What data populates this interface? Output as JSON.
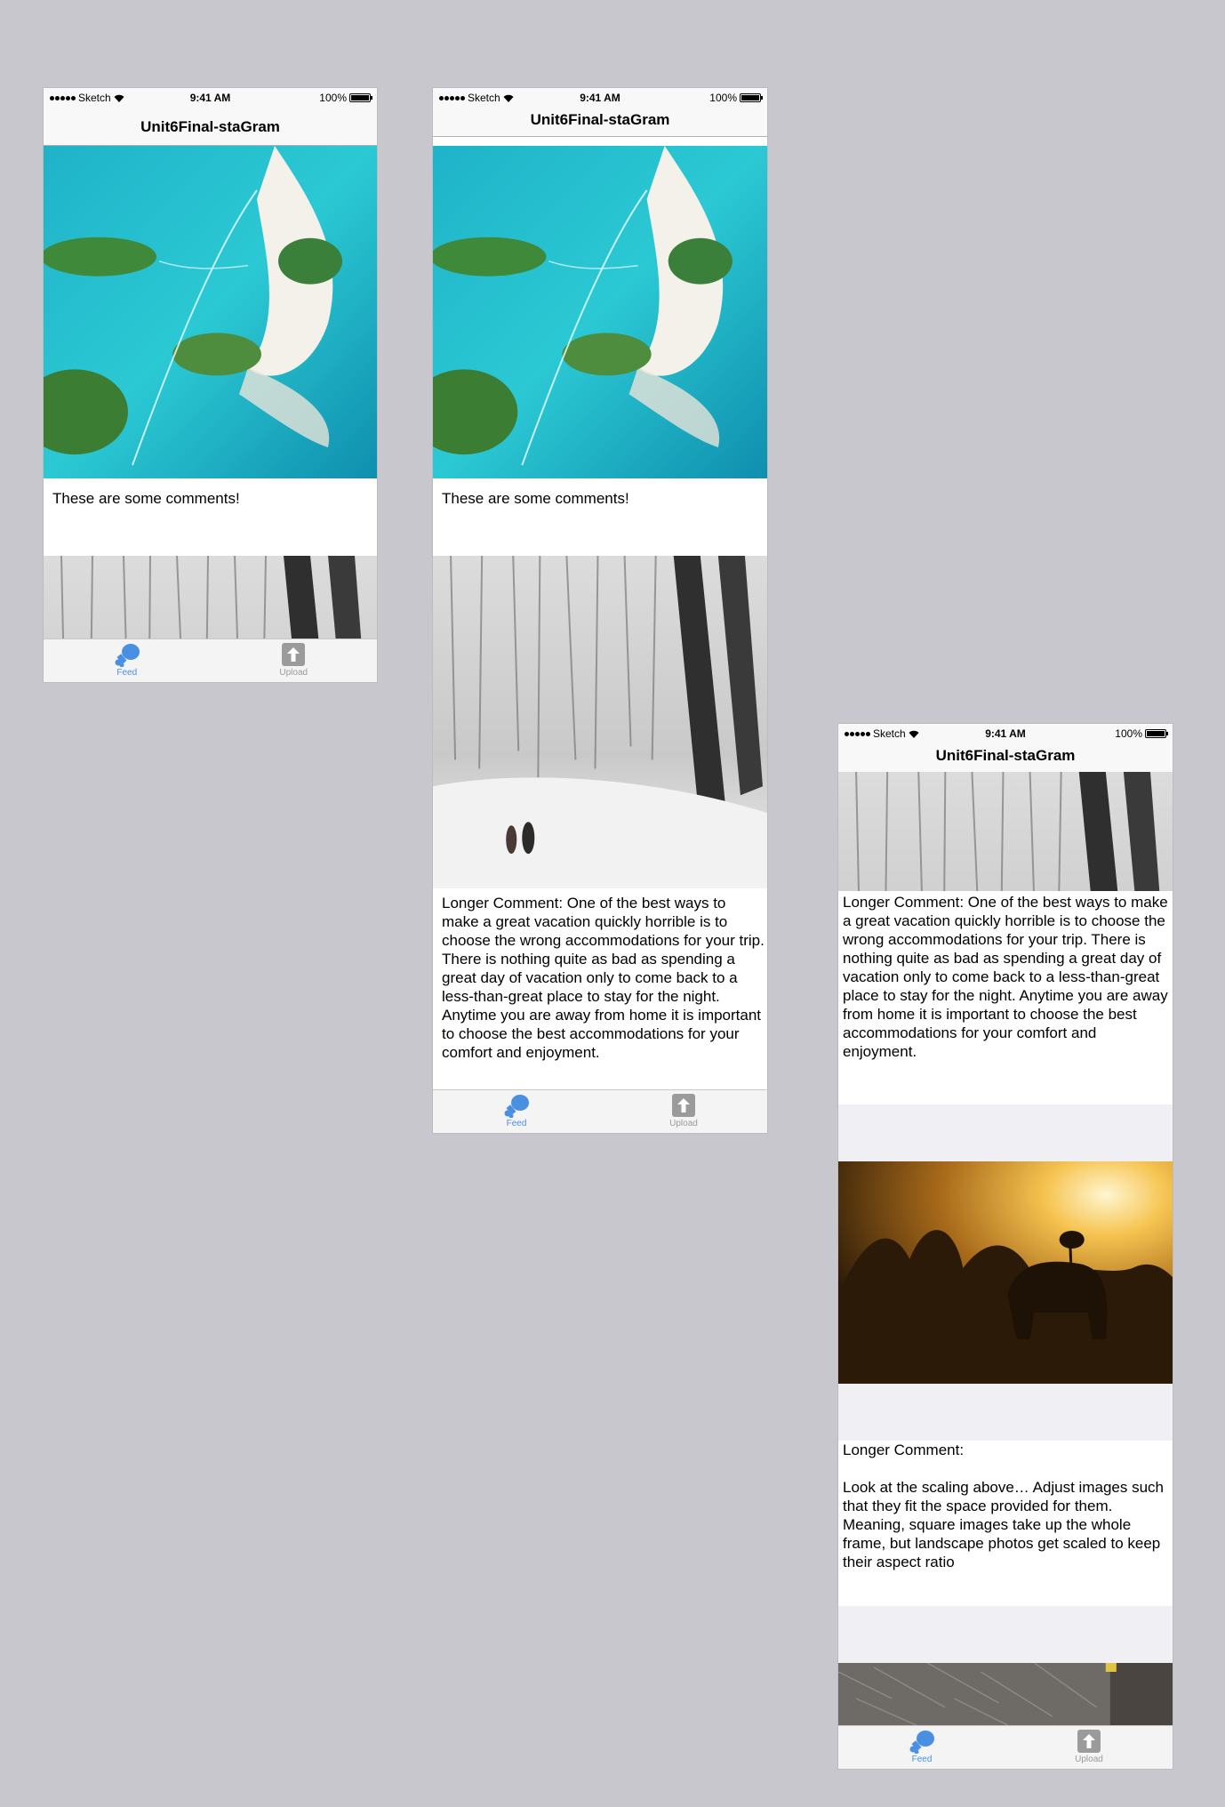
{
  "status_bar": {
    "carrier": "Sketch",
    "time": "9:41 AM",
    "battery": "100%"
  },
  "nav": {
    "title": "Unit6Final-staGram"
  },
  "tabs": {
    "feed": "Feed",
    "upload": "Upload"
  },
  "posts": {
    "short_comment": "These are some comments!",
    "longer_comment": "Longer Comment: One of the best ways to make a great vacation quickly horrible is to choose the wrong accommodations for your trip. There is nothing quite as bad as spending a great day of vacation only to come back to a less-than-great place to stay for the night. Anytime you are away from home it is important to choose the best accommodations for your comfort and enjoyment.",
    "scaling_comment": "Longer Comment:\n\nLook at the scaling above… Adjust images such that they fit the space provided for them. Meaning, square images take up the whole frame, but landscape photos get scaled to keep their aspect ratio"
  },
  "colors": {
    "accent": "#4a90e2",
    "background": "#c8c7cd",
    "gap": "#efeff4"
  },
  "icons": {
    "feed": "drumstick-icon",
    "upload": "upload-arrow-icon"
  }
}
